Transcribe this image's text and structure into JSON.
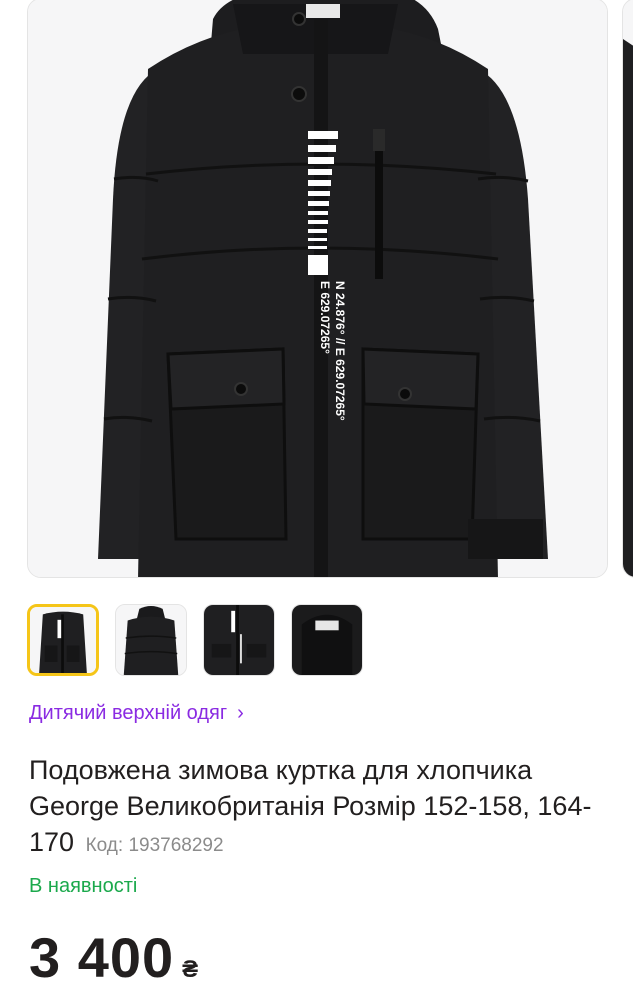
{
  "gallery": {
    "main_image": "black-winter-parka-jacket",
    "thumbnails": [
      {
        "name": "jacket-front",
        "active": true
      },
      {
        "name": "jacket-back",
        "active": false
      },
      {
        "name": "jacket-detail-print",
        "active": false
      },
      {
        "name": "jacket-label",
        "active": false
      }
    ],
    "print": {
      "line1": "N 24.876° // E 629.07265°",
      "line2": "E 629.07265°"
    }
  },
  "breadcrumb": {
    "label": "Дитячий верхній одяг",
    "chevron": "›"
  },
  "product": {
    "title": "Подовжена зимова куртка для хлопчика George Великобританія Розмір 152-158, 164-170",
    "code_label": "Код: 193768292"
  },
  "availability": "В наявності",
  "price": {
    "value": "3 400",
    "currency": "₴"
  },
  "colors": {
    "accent": "#8a2be2",
    "stock": "#1ba94c",
    "active_thumb": "#f5c518",
    "text": "#221f1f"
  }
}
